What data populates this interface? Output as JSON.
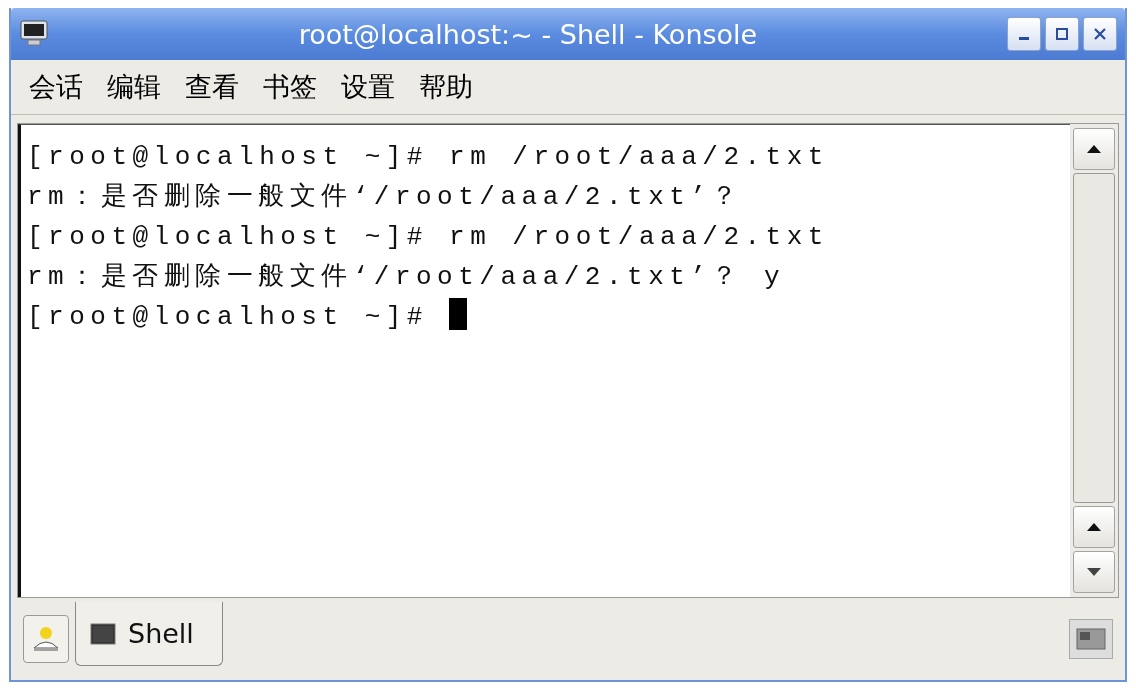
{
  "window": {
    "title": "root@localhost:~ - Shell - Konsole"
  },
  "menu": [
    "会话",
    "编辑",
    "查看",
    "书签",
    "设置",
    "帮助"
  ],
  "terminal": {
    "lines": [
      "[root@localhost ~]# rm /root/aaa/2.txt",
      "rm：是否删除一般文件‘/root/aaa/2.txt’？",
      "[root@localhost ~]# rm /root/aaa/2.txt",
      "rm：是否删除一般文件‘/root/aaa/2.txt’？ y",
      "[root@localhost ~]# "
    ],
    "cursor": true
  },
  "tabs": [
    {
      "label": "Shell",
      "selected": true
    }
  ]
}
